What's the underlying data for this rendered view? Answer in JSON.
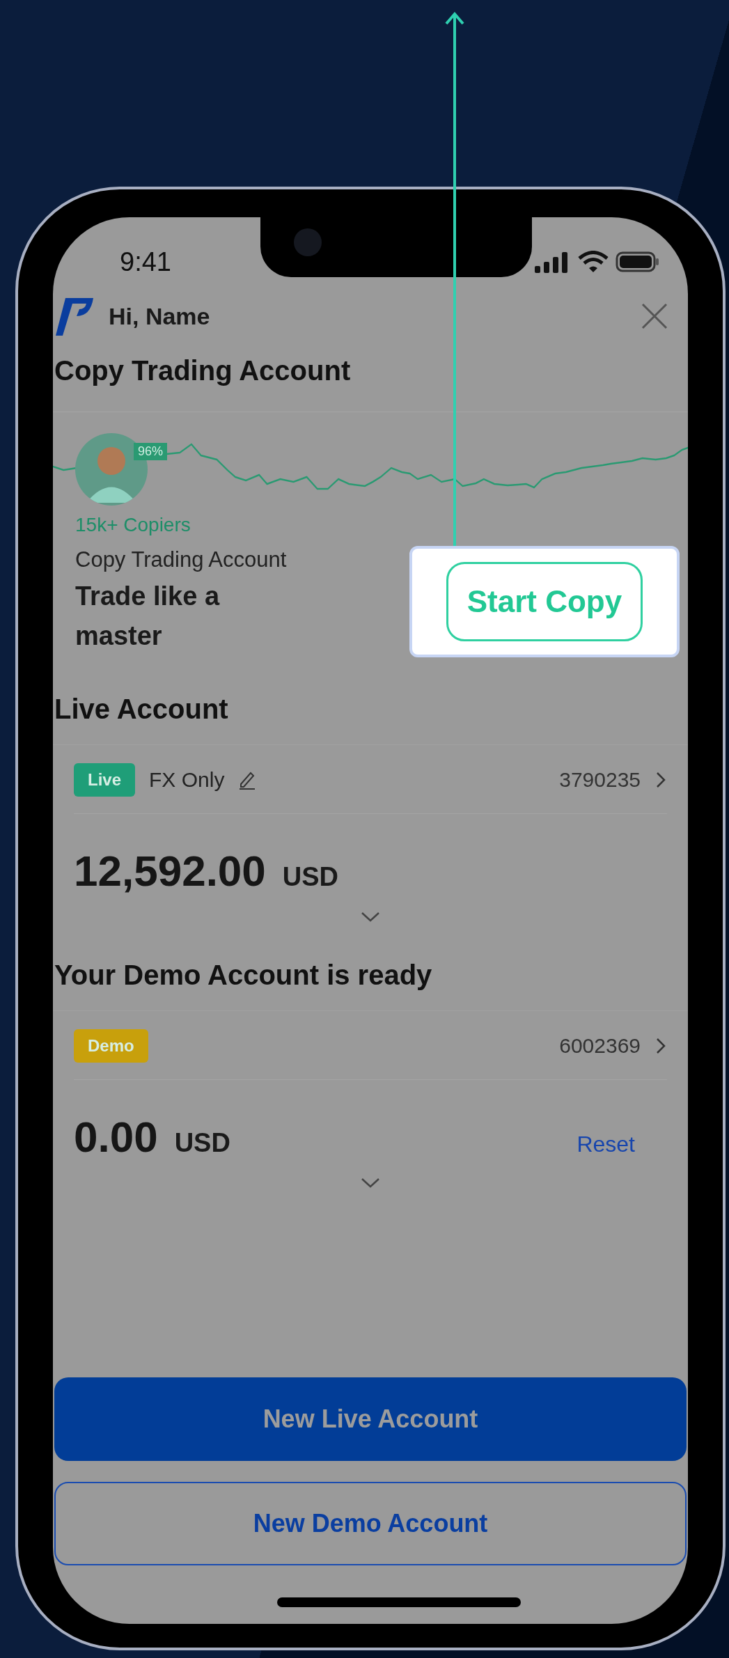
{
  "status_bar": {
    "time": "9:41"
  },
  "header": {
    "greeting": "Hi, Name"
  },
  "copy_trading": {
    "title": "Copy Trading Account",
    "win_rate": "96%",
    "copiers": "15k+ Copiers",
    "subtitle": "Copy Trading Account",
    "headline": "Trade like a master",
    "button": "Start Copy",
    "highlighted": true
  },
  "sections": [
    {
      "title": "Live Account",
      "account": {
        "kind": "live",
        "badge": "Live",
        "name": "FX Only",
        "number": "3790235",
        "balance": "12,592.00",
        "currency": "USD"
      }
    },
    {
      "title": "Your Demo Account is ready",
      "account": {
        "kind": "demo",
        "badge": "Demo",
        "number": "6002369",
        "balance": "0.00",
        "currency": "USD",
        "action": "Reset"
      }
    }
  ],
  "buttons": [
    {
      "kind": "primary",
      "label": "New Live Account"
    },
    {
      "kind": "outline",
      "label": "New Demo Account"
    }
  ]
}
